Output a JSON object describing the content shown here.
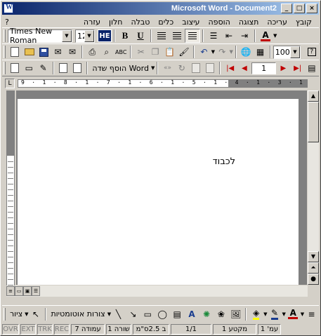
{
  "window": {
    "title": "Microsoft Word - Document2",
    "controls": {
      "minimize": "_",
      "maximize": "□",
      "close": "×"
    }
  },
  "menu": {
    "items": [
      "קובץ",
      "עריכה",
      "תצוגה",
      "הוספה",
      "עיצוב",
      "כלים",
      "טבלה",
      "חלון",
      "עזרה"
    ],
    "help_glyph": "?"
  },
  "formatting_toolbar": {
    "font_name": "Times New Roman",
    "font_size": "12",
    "language_button": "HE",
    "bold": "B",
    "underline": "U",
    "font_color_letter": "A",
    "font_color": "#c00000"
  },
  "standard_toolbar": {
    "zoom": "100%",
    "help": "?"
  },
  "fields_toolbar": {
    "insert_field_label": "הוסף שדה Word",
    "page_number": "1"
  },
  "document": {
    "text": "לכבוד"
  },
  "rulers": {
    "horizontal_text": "9 · 1 · 8 · 1 · 7 · 1 · 6 · 1 · 5 · 1 · 4 · 1 · 3 · 1 · 2 · 1 · 1 · 1 · ▽ · 1 · 1 · 2 · 1 · 3"
  },
  "drawing_toolbar": {
    "draw_menu": "ציור",
    "autoshapes_menu": "צורות אוטומטיות"
  },
  "status_bar": {
    "page": "עמ' 1",
    "section": "מקטע 1",
    "page_of": "1/1",
    "at": "ב 2.5ס\"מ",
    "line": "שורה 1",
    "column": "עמודה 7",
    "rec": "REC",
    "trk": "TRK",
    "ext": "EXT",
    "ovr": "OVR"
  },
  "colors": {
    "title_gradient_start": "#0a246a",
    "title_gradient_end": "#a6caf0",
    "chrome": "#d4d0c8",
    "highlight_color": "#ffff00"
  }
}
